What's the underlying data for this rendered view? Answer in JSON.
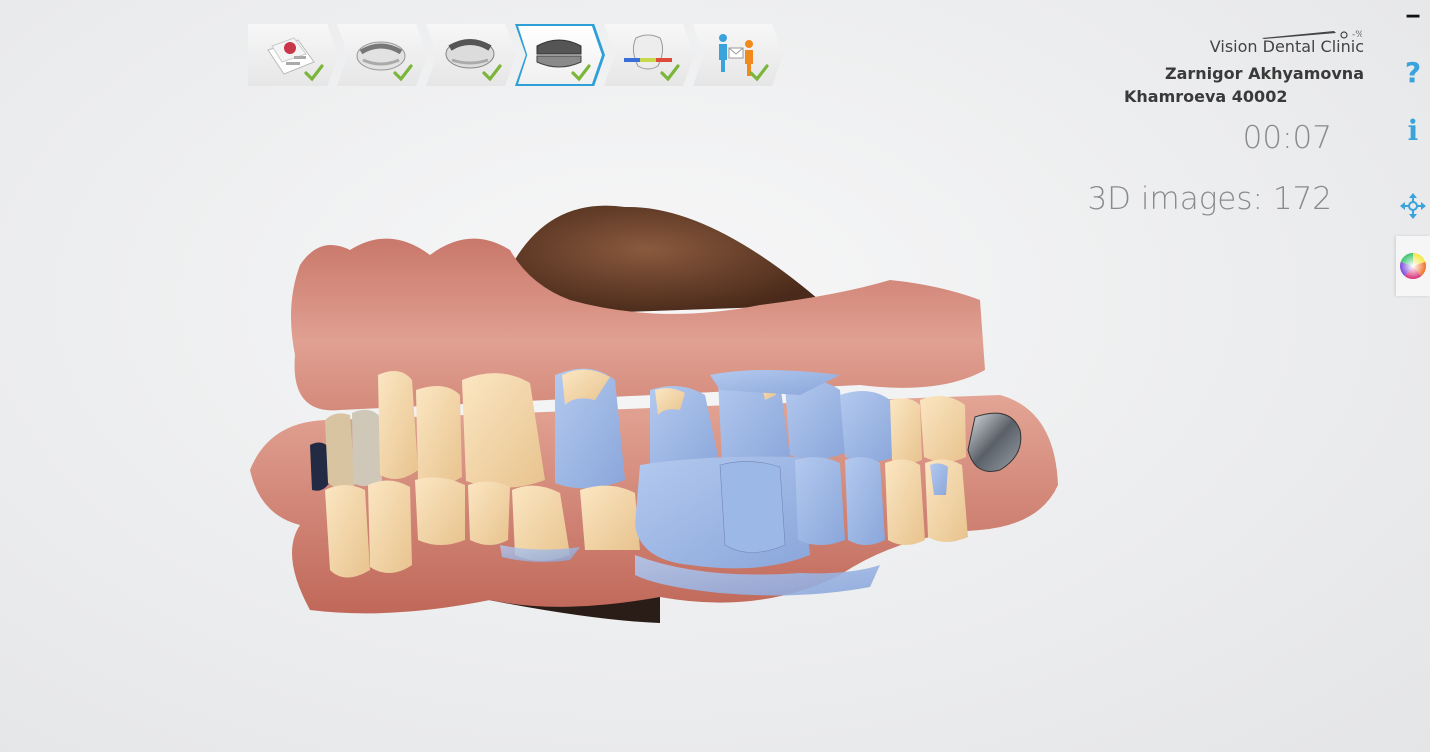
{
  "workflow": {
    "steps": [
      {
        "name": "rx",
        "label": "Rx",
        "completed": true
      },
      {
        "name": "upper-jaw-scan",
        "label": "Upper jaw",
        "completed": true
      },
      {
        "name": "lower-jaw-scan",
        "label": "Lower jaw",
        "completed": true
      },
      {
        "name": "bite-scan",
        "label": "Bite",
        "completed": true,
        "active": true
      },
      {
        "name": "occlusion-analysis",
        "label": "Analysis",
        "completed": true
      },
      {
        "name": "send",
        "label": "Send",
        "completed": true
      }
    ]
  },
  "patient": {
    "clinic": "Vision Dental Clinic",
    "name_line1": "Zarnigor Akhyamovna",
    "name_line2": "Khamroeva 40002"
  },
  "scan": {
    "timer": "00:07",
    "image_count_label": "3D images: 172"
  },
  "toolbar": {
    "minimize": "‒",
    "help": "?",
    "info": "i"
  },
  "colors": {
    "accent": "#3aa3dc",
    "check": "#7bb63a",
    "gum": "#d98b7a",
    "tooth": "#f1d4a4",
    "scan_blue": "#97b4e4"
  }
}
